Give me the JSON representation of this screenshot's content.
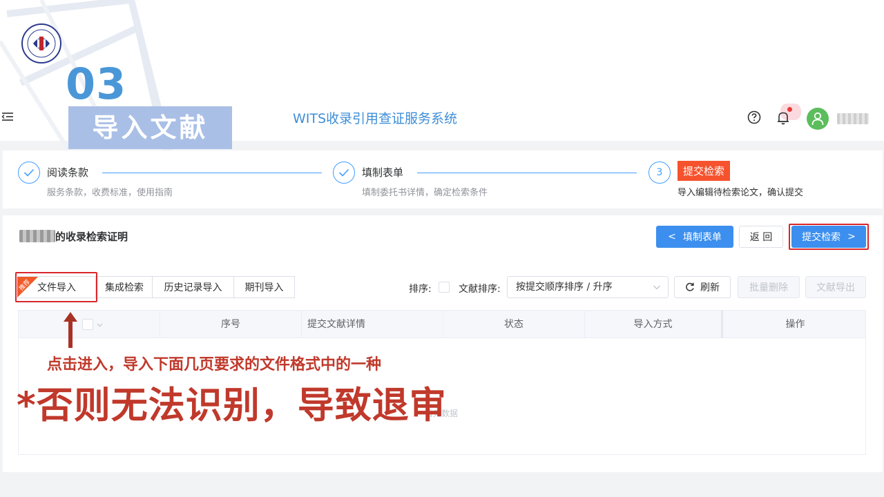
{
  "slide": {
    "number": "03",
    "title": "导入文献"
  },
  "header": {
    "app_title": "WITS收录引用查证服务系统"
  },
  "steps": [
    {
      "title": "阅读条款",
      "desc": "服务条款，收费标准，使用指南",
      "state": "done"
    },
    {
      "title": "填制表单",
      "desc": "填制委托书详情，确定检索条件",
      "state": "done"
    },
    {
      "number": "3",
      "title": "提交检索",
      "desc": "导入编辑待检索论文，确认提交",
      "state": "active"
    }
  ],
  "card": {
    "title": "的收录检索证明",
    "back_to_form": "填制表单",
    "back": "返 回",
    "submit": "提交检索"
  },
  "tabs": [
    "文件导入",
    "集成检索",
    "历史记录导入",
    "期刊导入"
  ],
  "badge": "推荐",
  "toolbar": {
    "sort_label": "排序:",
    "doc_sort_label": "文献排序:",
    "sort_value": "按提交顺序排序 / 升序",
    "refresh": "刷新",
    "batch_delete": "批量删除",
    "export": "文献导出"
  },
  "table": {
    "columns": [
      "序号",
      "提交文献详情",
      "状态",
      "导入方式",
      "操作"
    ],
    "empty_text": "暂无数据"
  },
  "annotations": {
    "line1": "点击进入，导入下面几页要求的文件格式中的一种",
    "line2": "*否则无法识别，导致退审"
  },
  "colors": {
    "accent": "#409eff",
    "primary_button": "#3c8fee",
    "highlight_red": "#d9262a",
    "annotation_red": "#c0392b",
    "badge_orange": "#f05a28",
    "active_step": "#f5522d"
  }
}
